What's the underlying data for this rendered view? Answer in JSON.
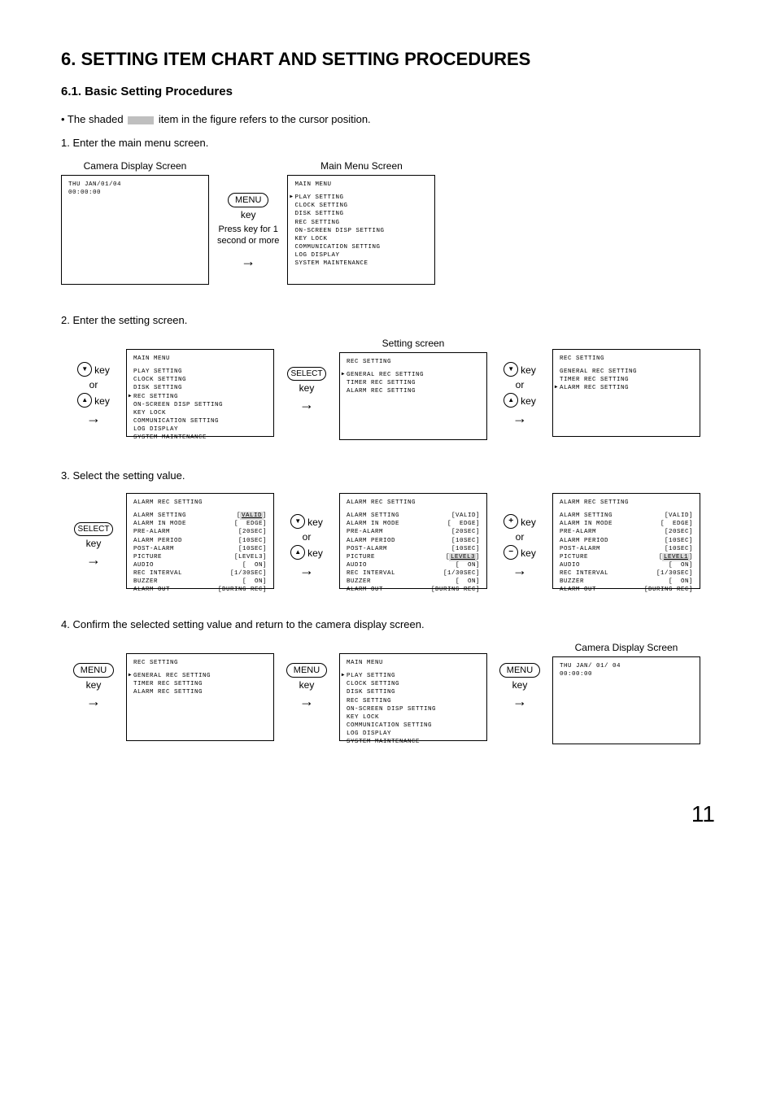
{
  "page": {
    "title": "6. SETTING ITEM CHART AND SETTING PROCEDURES",
    "subtitle": "6.1. Basic Setting Procedures",
    "intro_prefix": "• The shaded ",
    "intro_suffix": " item in the figure refers to the cursor position.",
    "step1": "1. Enter the main menu screen.",
    "step2": "2. Enter the setting screen.",
    "step3": "3. Select the setting value.",
    "step4": "4. Confirm the selected setting value and return to the camera display screen.",
    "pagenum": "11"
  },
  "labels": {
    "camera_display": "Camera Display Screen",
    "main_menu_screen": "Main Menu Screen",
    "setting_screen": "Setting screen",
    "menu_key": "MENU",
    "key_word": "key",
    "press_note_1": "Press key for 1",
    "press_note_2": "second or more",
    "select_key": "SELECT",
    "or": "or"
  },
  "camera": {
    "line1": "THU JAN/01/04",
    "line2": "00:00:00",
    "line1b": "THU  JAN/ 01/ 04",
    "line2b": "00:00:00"
  },
  "main_menu": {
    "title": "MAIN MENU",
    "items": [
      "PLAY SETTING",
      "CLOCK SETTING",
      "DISK SETTING",
      "REC SETTING",
      "ON-SCREEN DISP SETTING",
      "KEY LOCK",
      "COMMUNICATION SETTING",
      "LOG DISPLAY",
      "SYSTEM MAINTENANCE"
    ]
  },
  "rec_setting": {
    "title": "REC SETTING",
    "items": [
      "GENERAL REC SETTING",
      "TIMER REC SETTING",
      "ALARM REC SETTING"
    ]
  },
  "alarm_rec": {
    "title": "ALARM REC SETTING",
    "rows": [
      {
        "l": "ALARM SETTING",
        "v": "VALID"
      },
      {
        "l": "ALARM IN MODE",
        "v": "EDGE"
      },
      {
        "l": "PRE-ALARM",
        "v": "20SEC"
      },
      {
        "l": "ALARM PERIOD",
        "v": "10SEC"
      },
      {
        "l": "POST-ALARM",
        "v": "10SEC"
      },
      {
        "l": "PICTURE",
        "v": "LEVEL3"
      },
      {
        "l": "AUDIO",
        "v": "ON"
      },
      {
        "l": "REC INTERVAL",
        "v": "1/30SEC"
      },
      {
        "l": "BUZZER",
        "v": "ON"
      },
      {
        "l": "ALARM OUT",
        "v": "DURING REC"
      }
    ],
    "picture_level1": "LEVEL1"
  }
}
